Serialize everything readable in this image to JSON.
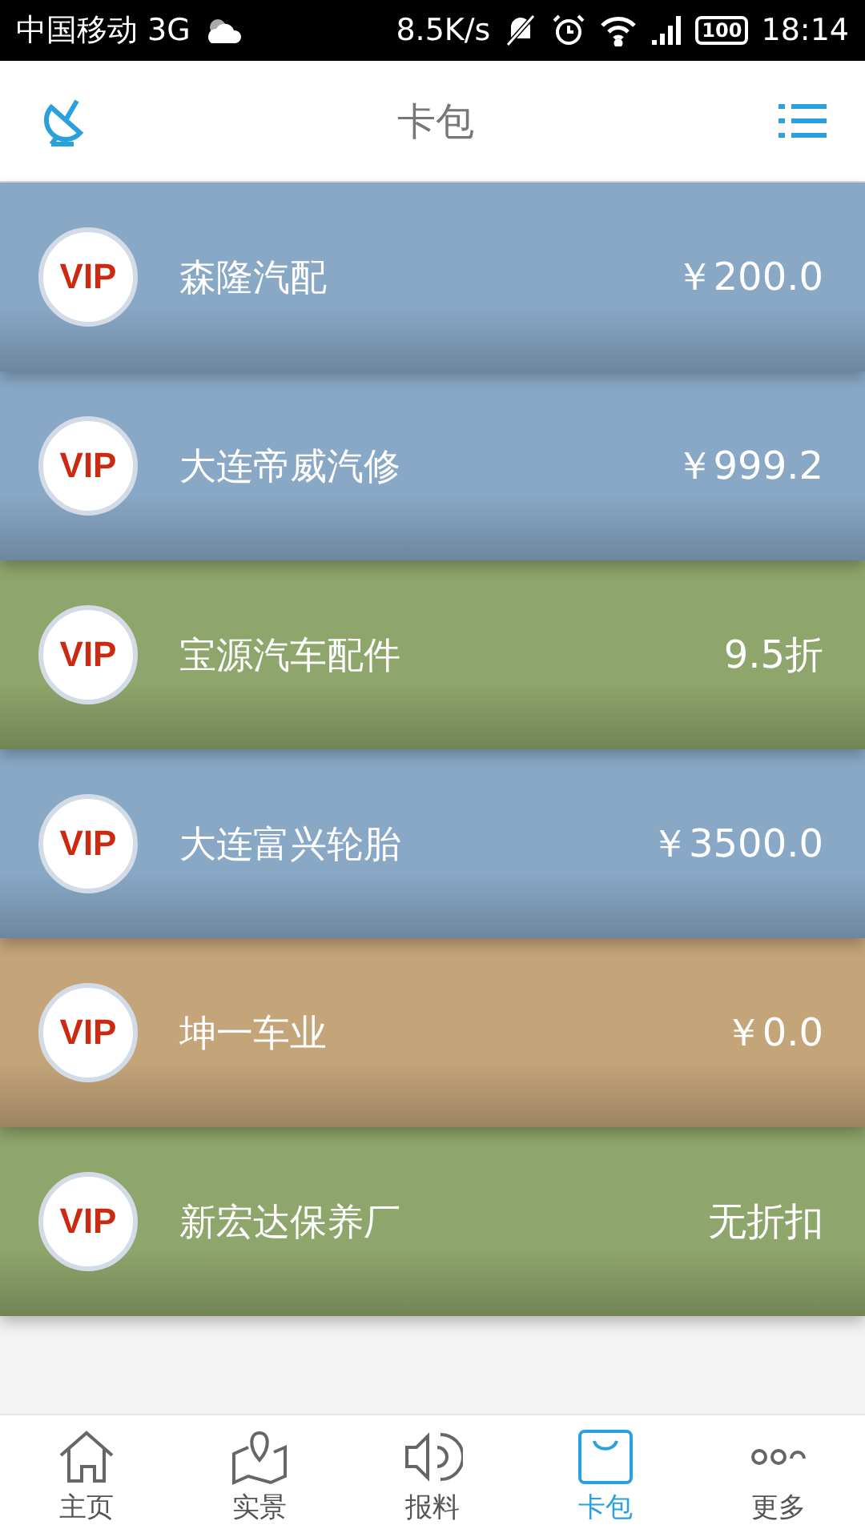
{
  "status_bar": {
    "carrier": "中国移动 3G",
    "speed": "8.5K/s",
    "battery": "100",
    "time": "18:14"
  },
  "header": {
    "title": "卡包"
  },
  "cards": [
    {
      "badge": "VIP",
      "name": "森隆汽配",
      "value": "￥200.0",
      "color": "#89a8c6"
    },
    {
      "badge": "VIP",
      "name": "大连帝威汽修",
      "value": "￥999.2",
      "color": "#89a8c6"
    },
    {
      "badge": "VIP",
      "name": "宝源汽车配件",
      "value": "9.5折",
      "color": "#8ea56b"
    },
    {
      "badge": "VIP",
      "name": "大连富兴轮胎",
      "value": "￥3500.0",
      "color": "#89a8c6"
    },
    {
      "badge": "VIP",
      "name": "坤一车业",
      "value": "￥0.0",
      "color": "#c4a57a"
    },
    {
      "badge": "VIP",
      "name": "新宏达保养厂",
      "value": "无折扣",
      "color": "#8ea56b"
    }
  ],
  "nav": [
    {
      "kind": "home",
      "label": "主页",
      "selected": false
    },
    {
      "kind": "map",
      "label": "实景",
      "selected": false
    },
    {
      "kind": "sound",
      "label": "报料",
      "selected": false
    },
    {
      "kind": "bag",
      "label": "卡包",
      "selected": true
    },
    {
      "kind": "more",
      "label": "更多",
      "selected": false
    }
  ]
}
